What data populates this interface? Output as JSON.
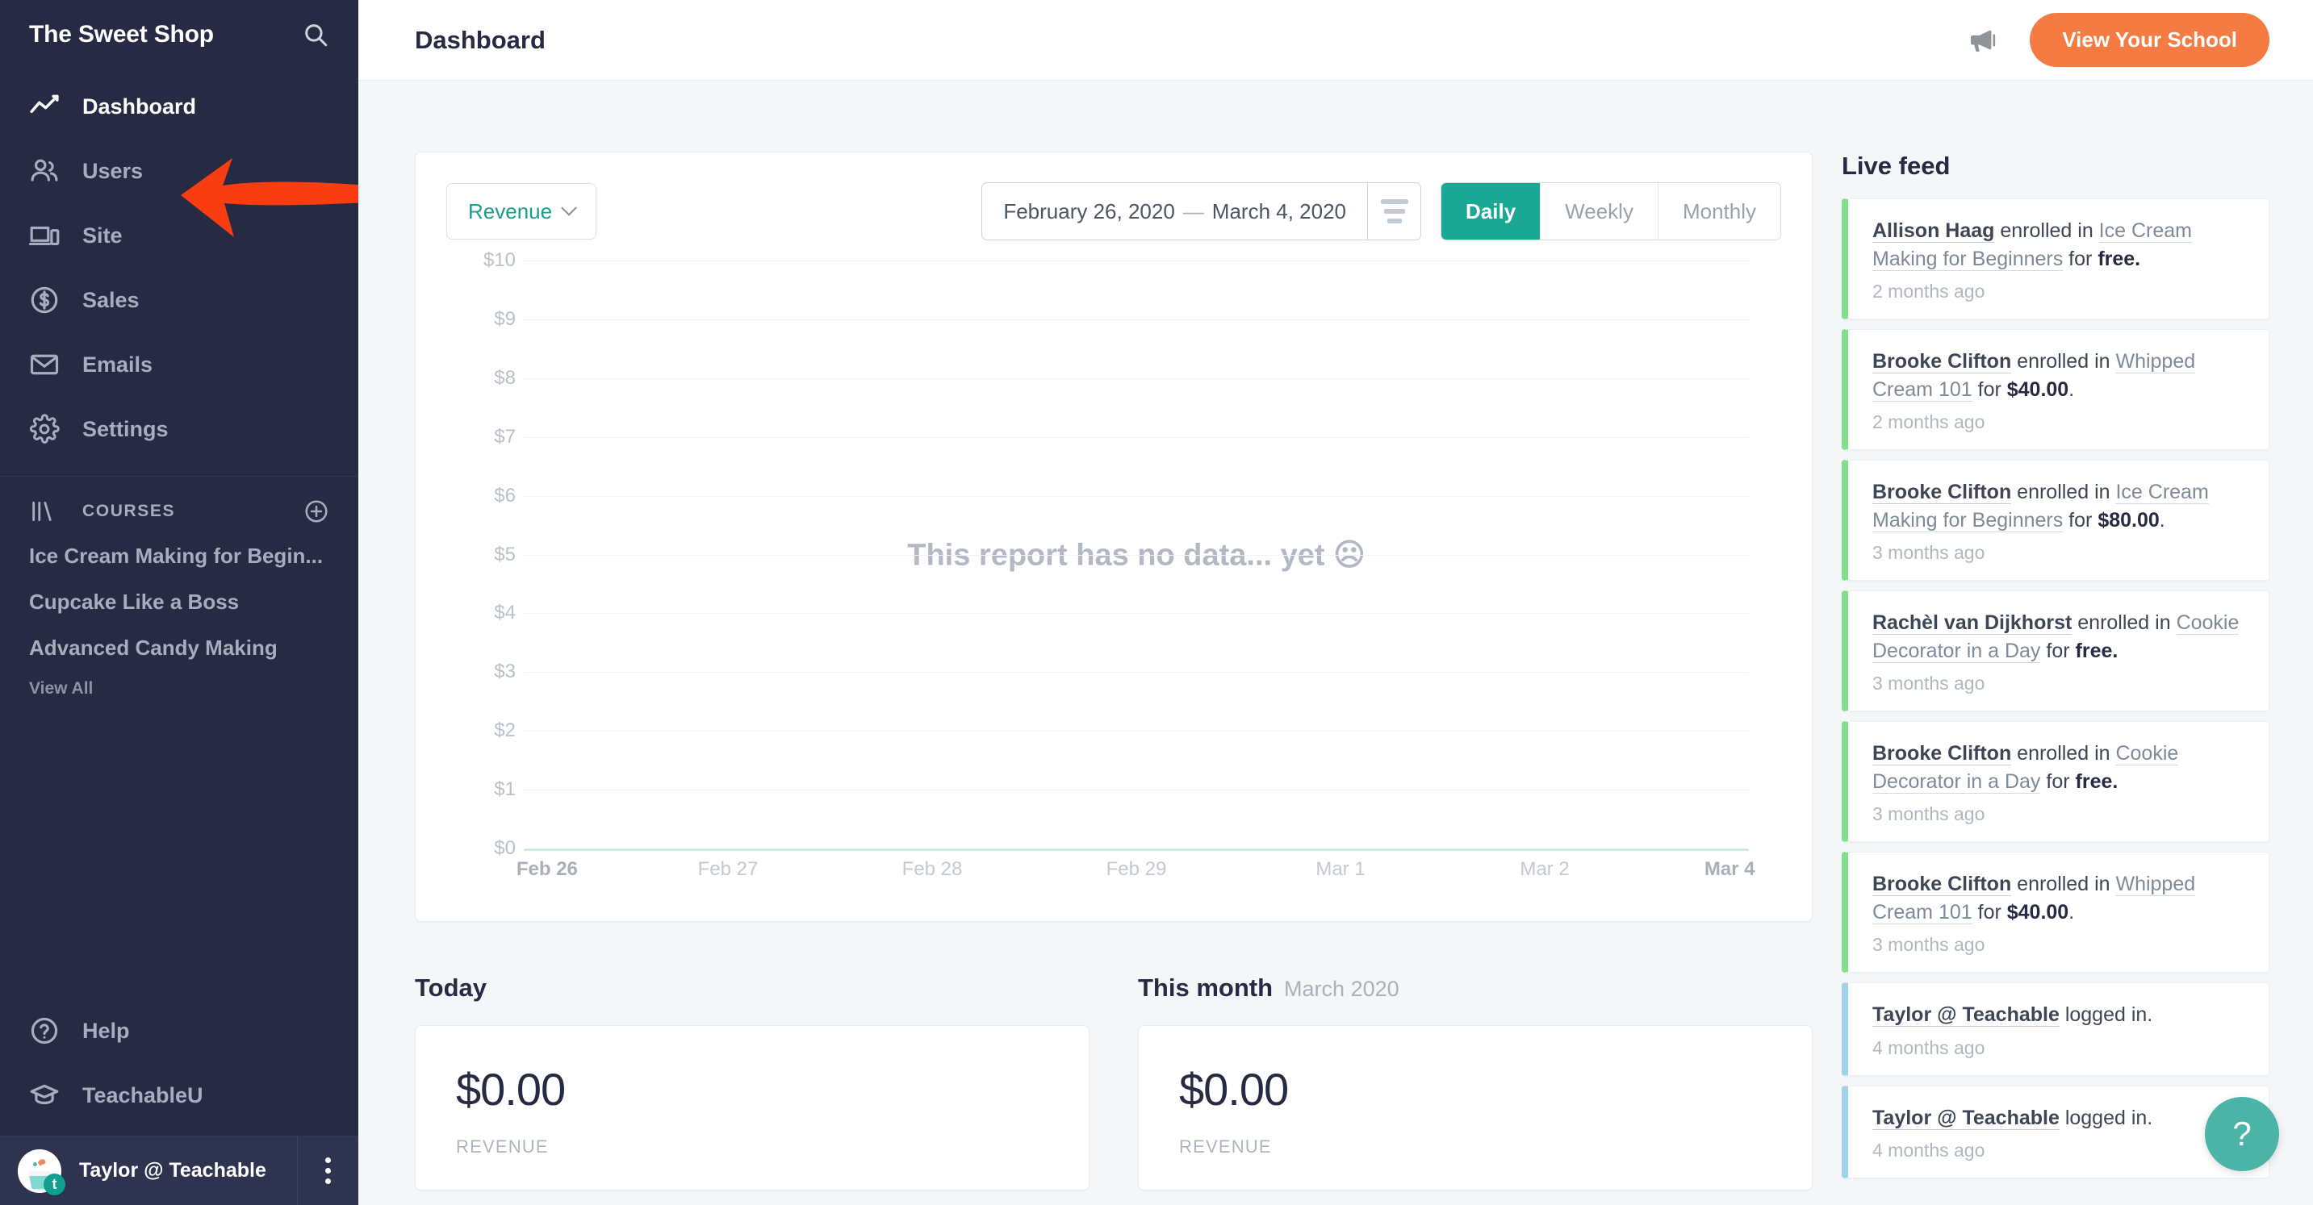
{
  "sidebar": {
    "brand": "The Sweet Shop",
    "search_icon": "search-icon",
    "nav": [
      {
        "label": "Dashboard",
        "icon": "line-chart-icon",
        "active": true
      },
      {
        "label": "Users",
        "icon": "users-icon",
        "active": false
      },
      {
        "label": "Site",
        "icon": "devices-icon",
        "active": false
      },
      {
        "label": "Sales",
        "icon": "dollar-circle-icon",
        "active": false
      },
      {
        "label": "Emails",
        "icon": "envelope-icon",
        "active": false
      },
      {
        "label": "Settings",
        "icon": "gear-icon",
        "active": false
      }
    ],
    "courses_section": {
      "icon": "books-icon",
      "title": "COURSES",
      "add_icon": "plus-circle-icon",
      "items": [
        "Ice Cream Making for Begin...",
        "Cupcake Like a Boss",
        "Advanced Candy Making"
      ],
      "view_all": "View All"
    },
    "bottom_nav": [
      {
        "label": "Help",
        "icon": "question-circle-icon"
      },
      {
        "label": "TeachableU",
        "icon": "graduation-cap-icon"
      }
    ],
    "user": {
      "name": "Taylor @ Teachable",
      "avatar_badge": "t",
      "more_icon": "kebab-menu-icon"
    }
  },
  "annotation": {
    "arrow_color": "#fa3c11",
    "points_to": "Users"
  },
  "header": {
    "title": "Dashboard",
    "megaphone_icon": "megaphone-icon",
    "view_school_label": "View Your School",
    "accent_color": "#f47b42"
  },
  "report": {
    "metric_label": "Revenue",
    "metric_chevron": "chevron-down-icon",
    "date_start": "February 26, 2020",
    "date_dash": "—",
    "date_end": "March 4, 2020",
    "sort_icon": "sort-lines-icon",
    "ranges": [
      {
        "label": "Daily",
        "selected": true
      },
      {
        "label": "Weekly",
        "selected": false
      },
      {
        "label": "Monthly",
        "selected": false
      }
    ],
    "empty_message": "This report has no data... yet ☹"
  },
  "chart_data": {
    "type": "line",
    "title": "Revenue",
    "xlabel": "",
    "ylabel": "",
    "x": [
      "Feb 26",
      "Feb 27",
      "Feb 28",
      "Feb 29",
      "Mar 1",
      "Mar 2",
      "Mar 4"
    ],
    "categories": [
      "Feb 26",
      "Feb 27",
      "Feb 28",
      "Feb 29",
      "Mar 1",
      "Mar 2",
      "Mar 4"
    ],
    "values": [
      0,
      0,
      0,
      0,
      0,
      0,
      0
    ],
    "series": [
      {
        "name": "Revenue",
        "values": [
          0,
          0,
          0,
          0,
          0,
          0,
          0
        ]
      }
    ],
    "ytick_labels": [
      "$10",
      "$9",
      "$8",
      "$7",
      "$6",
      "$5",
      "$4",
      "$3",
      "$2",
      "$1",
      "$0"
    ],
    "ylim": [
      0,
      10
    ],
    "ytick_values": [
      10,
      9,
      8,
      7,
      6,
      5,
      4,
      3,
      2,
      1,
      0
    ],
    "grid": true,
    "legend": false,
    "empty": true,
    "empty_message": "This report has no data... yet ☹",
    "line_color": "#cfe9e4"
  },
  "stats": [
    {
      "heading": "Today",
      "sub": "",
      "value": "$0.00",
      "label": "REVENUE"
    },
    {
      "heading": "This month",
      "sub": "March 2020",
      "value": "$0.00",
      "label": "REVENUE"
    }
  ],
  "live_feed": {
    "title": "Live feed",
    "items": [
      {
        "type": "enrollment",
        "person": "Allison Haag",
        "verb": " enrolled in ",
        "course": "Ice Cream Making for Beginners",
        "for": " for ",
        "amount": "free.",
        "time": "2 months ago"
      },
      {
        "type": "enrollment",
        "person": "Brooke Clifton",
        "verb": " enrolled in ",
        "course": "Whipped Cream 101",
        "for": " for ",
        "amount": "$40.00",
        "suffix": ".",
        "time": "2 months ago"
      },
      {
        "type": "enrollment",
        "person": "Brooke Clifton",
        "verb": " enrolled in ",
        "course": "Ice Cream Making for Beginners",
        "for": " for ",
        "amount": "$80.00",
        "suffix": ".",
        "time": "3 months ago"
      },
      {
        "type": "enrollment",
        "person": "Rachèl van Dijkhorst",
        "verb": " enrolled in ",
        "course": "Cookie Decorator in a Day",
        "for": " for ",
        "amount": "free.",
        "time": "3 months ago"
      },
      {
        "type": "enrollment",
        "person": "Brooke Clifton",
        "verb": " enrolled in ",
        "course": "Cookie Decorator in a Day",
        "for": " for ",
        "amount": "free.",
        "time": "3 months ago"
      },
      {
        "type": "enrollment",
        "person": "Brooke Clifton",
        "verb": " enrolled in ",
        "course": "Whipped Cream 101",
        "for": " for ",
        "amount": "$40.00",
        "suffix": ".",
        "time": "3 months ago"
      },
      {
        "type": "login",
        "person": "Taylor @ Teachable",
        "verb": " logged in.",
        "time": "4 months ago"
      },
      {
        "type": "login",
        "person": "Taylor @ Teachable",
        "verb": " logged in.",
        "time": "4 months ago"
      }
    ]
  },
  "help_fab": {
    "glyph": "?",
    "color": "#4cb3a7"
  }
}
